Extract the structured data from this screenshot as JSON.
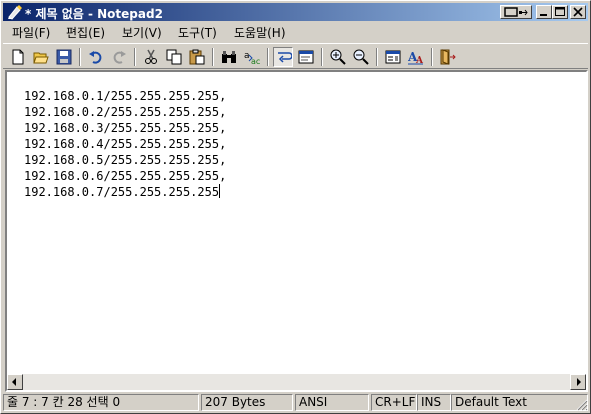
{
  "window": {
    "title": "* 제목 없음 - Notepad2",
    "accent": "#0a246a",
    "accent2": "#a6caf0",
    "controls": [
      "minimize-icon",
      "maximize-icon",
      "close-icon"
    ]
  },
  "menu": {
    "items": [
      {
        "label": "파일(F)"
      },
      {
        "label": "편집(E)"
      },
      {
        "label": "보기(V)"
      },
      {
        "label": "도구(T)"
      },
      {
        "label": "도움말(H)"
      }
    ]
  },
  "toolbar": {
    "buttons": [
      "new-icon",
      "open-icon",
      "save-icon",
      "undo-icon",
      "redo-icon",
      "cut-icon",
      "copy-icon",
      "paste-icon",
      "find-icon",
      "replace-icon",
      "word-wrap-icon",
      "settings-icon",
      "zoom-in-icon",
      "zoom-out-icon",
      "schemes-icon",
      "font-icon",
      "exit-icon"
    ],
    "pressed": "word-wrap-icon"
  },
  "editor": {
    "lines": [
      "192.168.0.1/255.255.255.255,",
      "192.168.0.2/255.255.255.255,",
      "192.168.0.3/255.255.255.255,",
      "192.168.0.4/255.255.255.255,",
      "192.168.0.5/255.255.255.255,",
      "192.168.0.6/255.255.255.255,",
      "192.168.0.7/255.255.255.255"
    ]
  },
  "status": {
    "position": "줄 7 : 7   칸 28   선택 0",
    "size": "207 Bytes",
    "encoding": "ANSI",
    "line_ending": "CR+LF",
    "mode": "INS",
    "scheme": "Default Text"
  }
}
